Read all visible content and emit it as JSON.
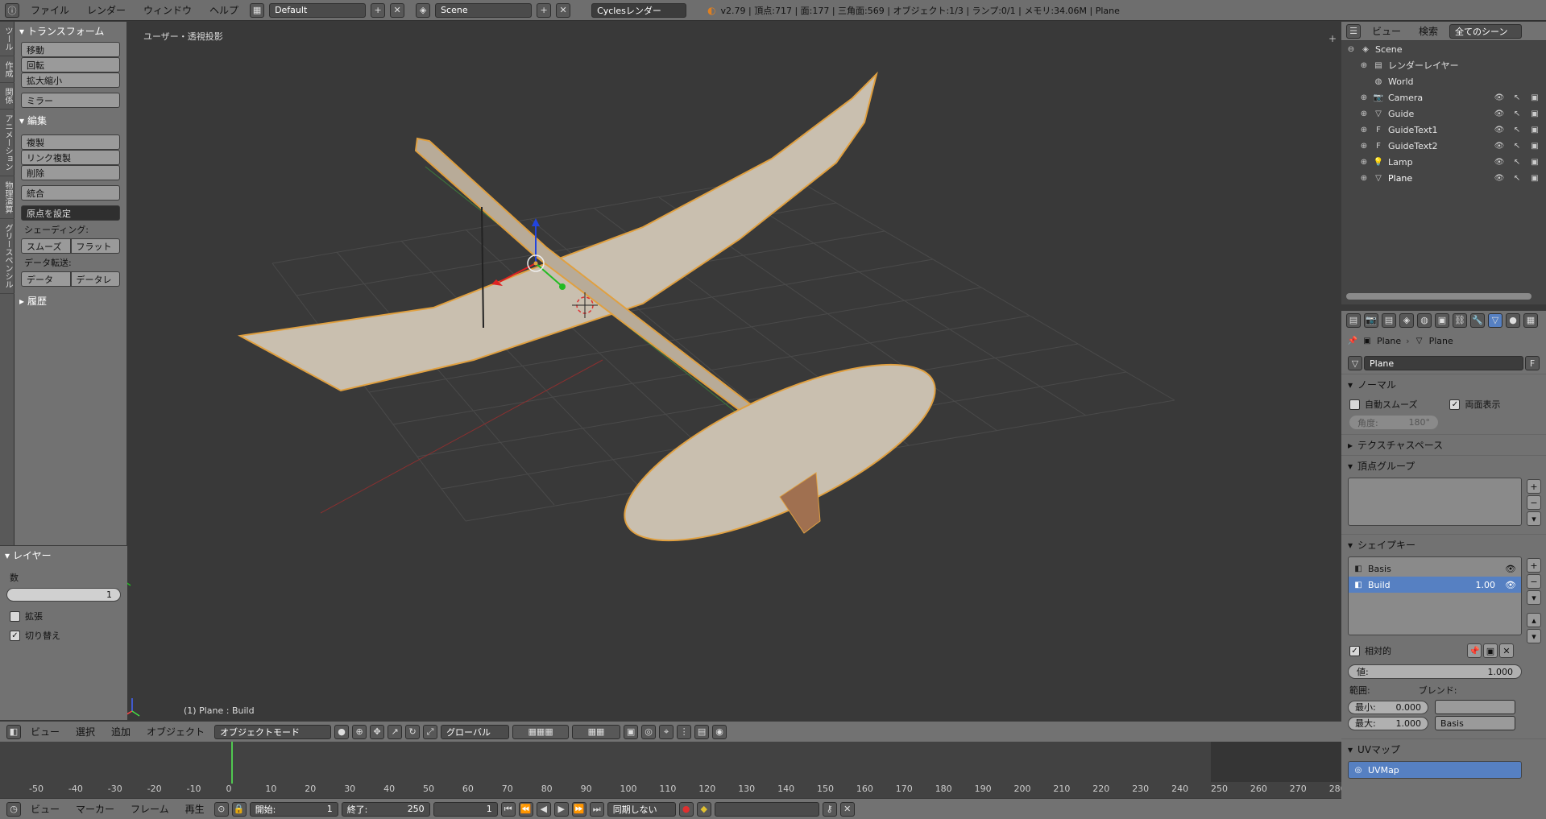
{
  "topbar": {
    "menus": [
      "ファイル",
      "レンダー",
      "ウィンドウ",
      "ヘルプ"
    ],
    "layout_name": "Default",
    "scene_name": "Scene",
    "render_engine": "Cyclesレンダー",
    "stats": "v2.79 | 頂点:717 | 面:177 | 三角面:569 | オブジェクト:1/3 | ランプ:0/1 | メモリ:34.06M | Plane"
  },
  "tabs": [
    "ツール",
    "作成",
    "関係",
    "アニメーション",
    "物理演算",
    "グリースペンシル"
  ],
  "toolshelf": {
    "transform_title": "トランスフォーム",
    "move": "移動",
    "rotate": "回転",
    "scale": "拡大縮小",
    "mirror": "ミラー",
    "edit_title": "編集",
    "duplicate": "複製",
    "link_duplicate": "リンク複製",
    "delete": "削除",
    "join": "統合",
    "set_origin": "原点を設定",
    "shading_label": "シェーディング:",
    "smooth": "スムーズ",
    "flat": "フラット",
    "data_transfer_label": "データ転送:",
    "data": "データ",
    "data_layout": "データレ",
    "history_title": "履歴"
  },
  "layer_panel": {
    "title": "レイヤー",
    "count_label": "数",
    "count_value": "1",
    "extend_label": "拡張",
    "toggle_label": "切り替え"
  },
  "viewport": {
    "view_label": "ユーザー・透視投影",
    "status": "(1) Plane : Build"
  },
  "view3d_header": {
    "menus": [
      "ビュー",
      "選択",
      "追加",
      "オブジェクト"
    ],
    "mode": "オブジェクトモード",
    "orientation": "グローバル"
  },
  "timeline": {
    "ticks": [
      "-50",
      "-40",
      "-30",
      "-20",
      "-10",
      "0",
      "10",
      "20",
      "30",
      "40",
      "50",
      "60",
      "70",
      "80",
      "90",
      "100",
      "110",
      "120",
      "130",
      "140",
      "150",
      "160",
      "170",
      "180",
      "190",
      "200",
      "210",
      "220",
      "230",
      "240",
      "250",
      "260",
      "270",
      "280"
    ],
    "current_frame": "1",
    "menus": [
      "ビュー",
      "マーカー",
      "フレーム",
      "再生"
    ],
    "start_label": "開始:",
    "start_value": "1",
    "end_label": "終了:",
    "end_value": "250",
    "sync": "同期しない"
  },
  "outliner": {
    "menus": [
      "ビュー",
      "検索"
    ],
    "filter": "全てのシーン",
    "items": [
      {
        "label": "Scene"
      },
      {
        "label": "レンダーレイヤー"
      },
      {
        "label": "World"
      },
      {
        "label": "Camera"
      },
      {
        "label": "Guide"
      },
      {
        "label": "GuideText1"
      },
      {
        "label": "GuideText2"
      },
      {
        "label": "Lamp"
      },
      {
        "label": "Plane"
      }
    ]
  },
  "properties": {
    "breadcrumb_object": "Plane",
    "breadcrumb_data": "Plane",
    "mesh_name": "Plane",
    "fake_user": "F",
    "normals_title": "ノーマル",
    "auto_smooth": "自動スムーズ",
    "double_sided": "両面表示",
    "angle": "角度:",
    "angle_value": "180°",
    "texture_space_title": "テクスチャスペース",
    "vertex_groups_title": "頂点グループ",
    "shape_keys_title": "シェイプキー",
    "shape_keys": [
      {
        "name": "Basis",
        "value": ""
      },
      {
        "name": "Build",
        "value": "1.00"
      }
    ],
    "relative": "相対的",
    "value_label": "値:",
    "value": "1.000",
    "range_label": "範囲:",
    "blend_label": "ブレンド:",
    "min_label": "最小:",
    "min_value": "0.000",
    "max_label": "最大:",
    "max_value": "1.000",
    "blend_value": "Basis",
    "uvmaps_title": "UVマップ",
    "uvmap": "UVMap"
  }
}
